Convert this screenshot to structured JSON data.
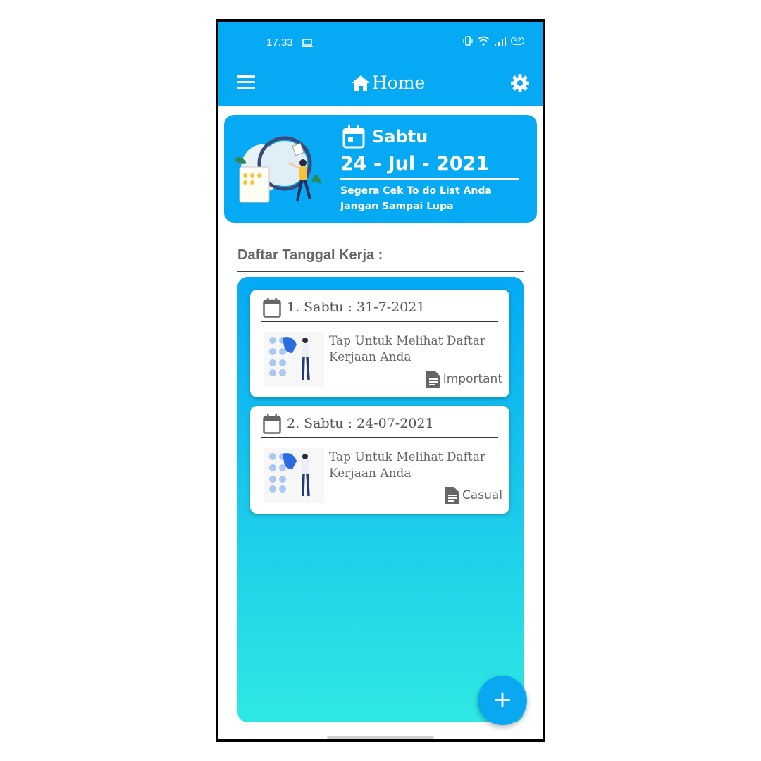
{
  "status_bar": {
    "time": "17.33",
    "battery": "92"
  },
  "app_bar": {
    "title": "Home"
  },
  "banner": {
    "day": "Sabtu",
    "date": "24 - Jul - 2021",
    "message_line1": "Segera Cek To do List Anda",
    "message_line2": "Jangan Sampai Lupa"
  },
  "section_title": "Daftar Tanggal Kerja :",
  "cards": [
    {
      "header": "1. Sabtu  :  31-7-2021",
      "text": "Tap Untuk Melihat Daftar Kerjaan Anda",
      "tag": "Important"
    },
    {
      "header": "2. Sabtu  :  24-07-2021",
      "text": "Tap Untuk Melihat Daftar Kerjaan Anda",
      "tag": "Casual"
    }
  ],
  "fab": {
    "label": "+"
  },
  "colors": {
    "primary": "#06a9f4",
    "gradient_end": "#2ee9e3",
    "text_gray": "#666666"
  },
  "icons": [
    "menu-icon",
    "home-icon",
    "gear-icon",
    "calendar-icon",
    "document-icon",
    "wifi-icon",
    "signal-icon",
    "vibrate-icon",
    "laptop-icon",
    "plus-icon"
  ]
}
